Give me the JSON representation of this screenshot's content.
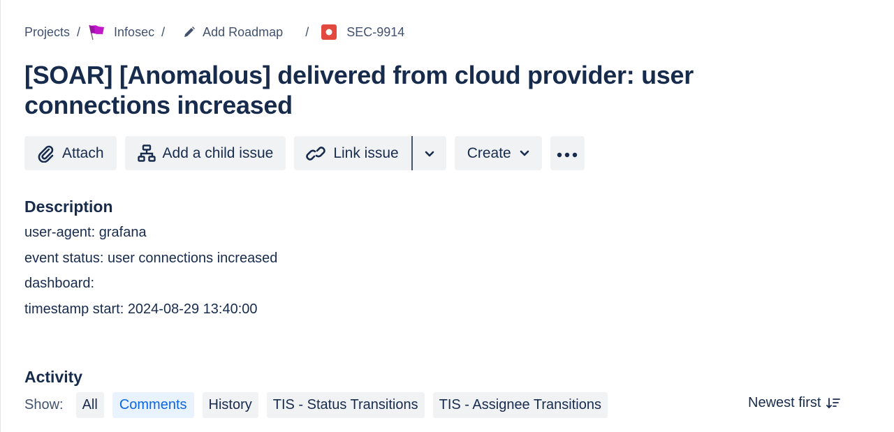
{
  "breadcrumb": {
    "items": [
      {
        "label": "Projects",
        "icon": null
      },
      {
        "label": "Infosec",
        "icon": "purple-flag-icon",
        "icon_color": "#c118c9"
      },
      {
        "label": "Add Roadmap",
        "icon": "pencil-icon"
      },
      {
        "label": "SEC-9914",
        "icon": "bug-issue-icon",
        "icon_color": "#e2483d"
      }
    ],
    "separator": "/"
  },
  "issue": {
    "title": "[SOAR] [Anomalous] delivered from cloud provider: user connections increased"
  },
  "toolbar": {
    "attach_label": "Attach",
    "add_child_label": "Add a child issue",
    "link_issue_label": "Link issue",
    "create_label": "Create",
    "more_label": "More actions"
  },
  "description": {
    "heading": "Description",
    "lines": [
      "user-agent: grafana",
      "event status: user connections increased",
      "dashboard:",
      "timestamp start: 2024-08-29 13:40:00"
    ]
  },
  "activity": {
    "heading": "Activity",
    "show_label": "Show:",
    "filters": [
      {
        "label": "All",
        "active": false
      },
      {
        "label": "Comments",
        "active": true
      },
      {
        "label": "History",
        "active": false
      },
      {
        "label": "TIS - Status Transitions",
        "active": false
      },
      {
        "label": "TIS - Assignee Transitions",
        "active": false
      }
    ],
    "sort_label": "Newest first"
  },
  "colors": {
    "text": "#172b4d",
    "button_bg": "#f1f2f4",
    "active_chip_bg": "#e9f2ff",
    "active_chip_text": "#0c66e4"
  }
}
